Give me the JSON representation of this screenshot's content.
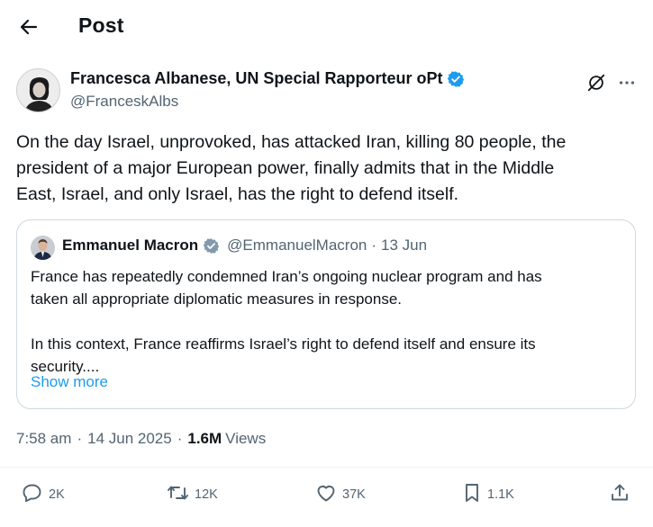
{
  "header": {
    "title": "Post",
    "back_icon": "back-arrow-icon"
  },
  "post": {
    "author_name": "Francesca Albanese, UN Special Rapporteur oPt",
    "author_handle": "@FranceskAlbs",
    "verified_color": "#1d9bf0",
    "text_lines": [
      "On the day Israel, unprovoked, has attacked Iran, killing 80 people, the",
      "president of a major European power, finally admits that in the Middle",
      "East, Israel, and only Israel, has the right to defend itself."
    ]
  },
  "quote": {
    "author_name": "Emmanuel Macron",
    "author_handle": "@EmmanuelMacron",
    "separator": "·",
    "date": "13 Jun",
    "paragraph1_lines": [
      "France has repeatedly condemned Iran’s ongoing nuclear program and has",
      "taken all appropriate diplomatic measures in response."
    ],
    "paragraph2_lines": [
      "In this context, France reaffirms Israel’s right to defend itself and ensure its",
      "security...."
    ],
    "show_more": "Show more"
  },
  "meta": {
    "time": "7:58 am",
    "dot1": "·",
    "date": "14 Jun 2025",
    "dot2": "·",
    "views_count": "1.6M",
    "views_label": "Views"
  },
  "actions": {
    "reply_count": "2K",
    "repost_count": "12K",
    "like_count": "37K",
    "bookmark_count": "1.1K"
  },
  "colors": {
    "text": "#0f1419",
    "secondary": "#536471",
    "link": "#1d9bf0",
    "border": "#cfd9de"
  }
}
